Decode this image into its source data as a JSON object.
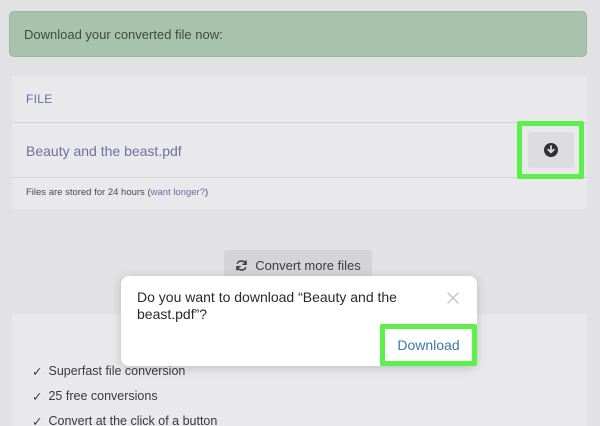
{
  "banner": {
    "text": "Download your converted file now:"
  },
  "file_table": {
    "header": "FILE",
    "file_name": "Beauty and the beast.pdf",
    "download_icon": "download-circle-icon",
    "storage_note": "Files are stored for 24 hours (",
    "storage_link": "want longer?",
    "storage_note_end": ")"
  },
  "convert_more": {
    "icon": "refresh-icon",
    "label": "Convert more files"
  },
  "features": {
    "check": "✓",
    "items": [
      "Superfast file conversion",
      "25 free conversions",
      "Convert at the click of a button"
    ]
  },
  "dialog": {
    "message": "Do you want to download “Beauty and the beast.pdf”?",
    "close_icon": "close-icon",
    "download_label": "Download"
  },
  "colors": {
    "highlight": "#5cf04a",
    "banner_bg": "#a8c3ab",
    "link": "#6e6ea6",
    "dialog_button": "#3b79a8"
  }
}
